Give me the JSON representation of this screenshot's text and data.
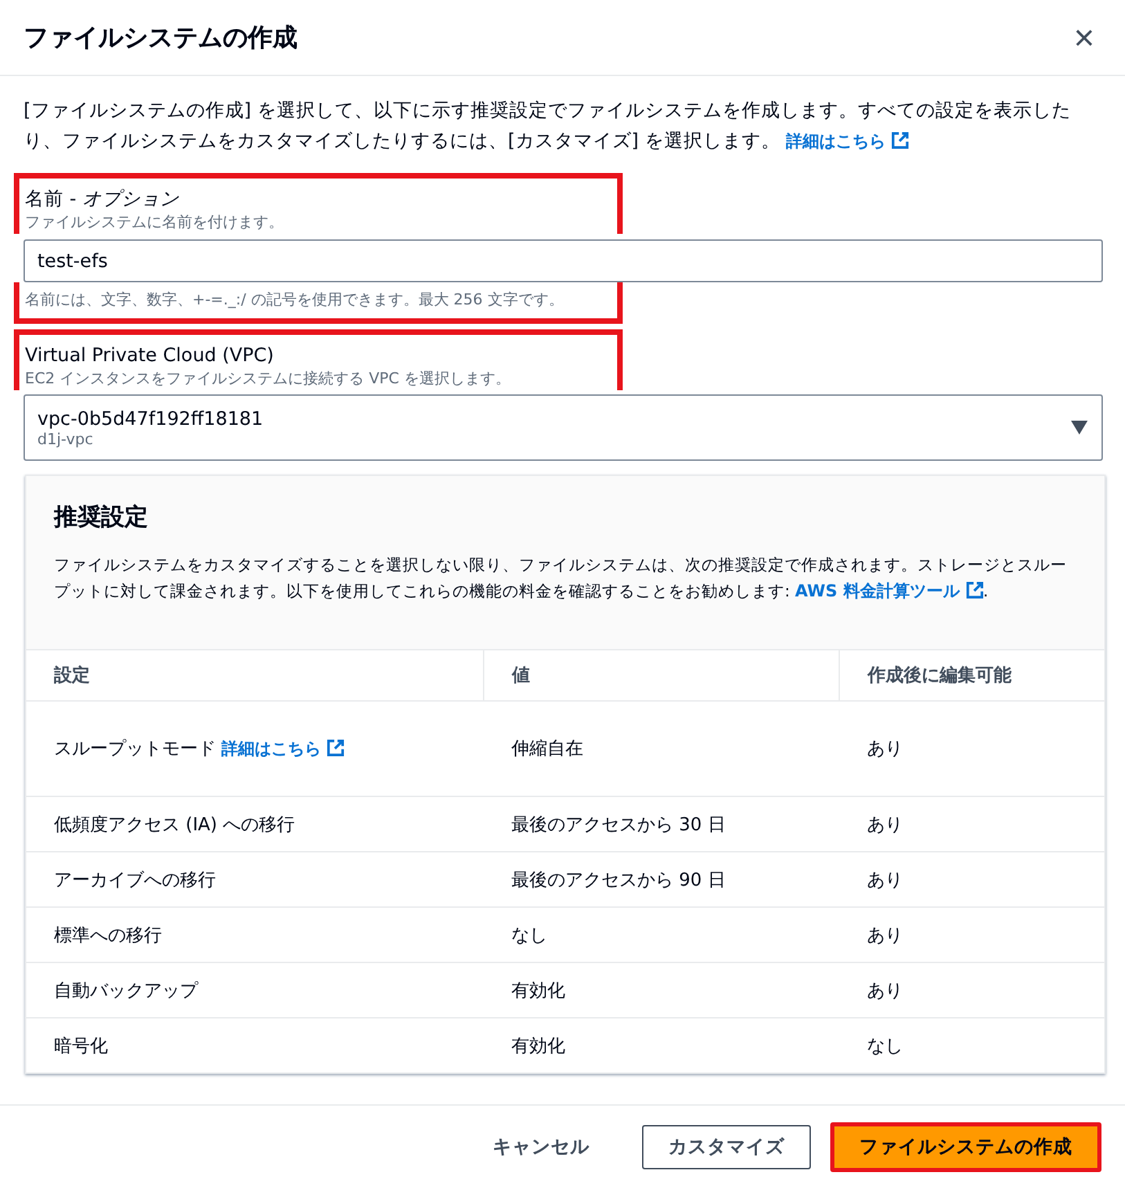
{
  "dialog": {
    "title": "ファイルシステムの作成",
    "close": "×"
  },
  "intro": {
    "text": "[ファイルシステムの作成] を選択して、以下に示す推奨設定でファイルシステムを作成します。すべての設定を表示したり、ファイルシステムをカスタマイズしたりするには、[カスタマイズ] を選択します。",
    "link": "詳細はこちら"
  },
  "name_field": {
    "label": "名前 - ",
    "label_optional": "オプション",
    "description": "ファイルシステムに名前を付けます。",
    "value": "test-efs",
    "constraint": "名前には、文字、数字、+-=._:/ の記号を使用できます。最大 256 文字です。",
    "highlighted": true
  },
  "vpc_field": {
    "label": "Virtual Private Cloud (VPC)",
    "description": "EC2 インスタンスをファイルシステムに接続する VPC を選択します。",
    "value": "vpc-0b5d47f192ff18181",
    "value_detail": "d1j-vpc",
    "highlighted": true
  },
  "recommended": {
    "title": "推奨設定",
    "description": "ファイルシステムをカスタマイズすることを選択しない限り、ファイルシステムは、次の推奨設定で作成されます。ストレージとスループットに対して課金されます。以下を使用してこれらの機能の料金を確認することをお勧めします: ",
    "link": "AWS 料金計算ツール",
    "link_suffix": ".",
    "columns": [
      "設定",
      "値",
      "作成後に編集可能"
    ],
    "rows": [
      {
        "setting": "スループットモード",
        "link": "詳細はこちら",
        "value": "伸縮自在",
        "editable": "あり"
      },
      {
        "setting": "低頻度アクセス (IA) への移行",
        "value": "最後のアクセスから 30 日",
        "editable": "あり"
      },
      {
        "setting": "アーカイブへの移行",
        "value": "最後のアクセスから 90 日",
        "editable": "あり"
      },
      {
        "setting": "標準への移行",
        "value": "なし",
        "editable": "あり"
      },
      {
        "setting": "自動バックアップ",
        "value": "有効化",
        "editable": "あり"
      },
      {
        "setting": "暗号化",
        "value": "有効化",
        "editable": "なし"
      }
    ]
  },
  "footer": {
    "buttons": [
      {
        "label": "キャンセル",
        "kind": "link",
        "highlighted": false
      },
      {
        "label": "カスタマイズ",
        "kind": "normal",
        "highlighted": false
      },
      {
        "label": "ファイルシステムの作成",
        "kind": "primary",
        "highlighted": true
      }
    ]
  }
}
